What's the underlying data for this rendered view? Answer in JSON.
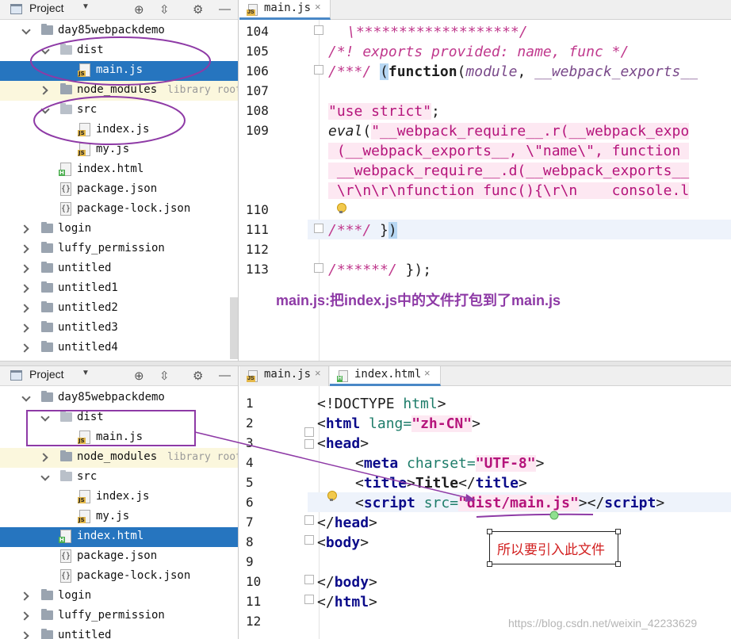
{
  "project_panel": {
    "title": "Project",
    "top_tree": [
      {
        "label": "day85webpackdemo",
        "type": "folder",
        "arrow": "down",
        "indent": 0
      },
      {
        "label": "dist",
        "type": "folder-light",
        "arrow": "down",
        "indent": 1
      },
      {
        "label": "main.js",
        "type": "js",
        "indent": 2,
        "selected": true
      },
      {
        "label": "node_modules",
        "type": "folder",
        "arrow": "right",
        "indent": 1,
        "extra": "library root"
      },
      {
        "label": "src",
        "type": "folder-light",
        "arrow": "down",
        "indent": 1
      },
      {
        "label": "index.js",
        "type": "js",
        "indent": 2
      },
      {
        "label": "my.js",
        "type": "js",
        "indent": 2
      },
      {
        "label": "index.html",
        "type": "html",
        "indent": 1
      },
      {
        "label": "package.json",
        "type": "json",
        "indent": 1
      },
      {
        "label": "package-lock.json",
        "type": "json",
        "indent": 1
      },
      {
        "label": "login",
        "type": "folder",
        "arrow": "right",
        "indent": 0
      },
      {
        "label": "luffy_permission",
        "type": "folder",
        "arrow": "right",
        "indent": 0
      },
      {
        "label": "untitled",
        "type": "folder",
        "arrow": "right",
        "indent": 0
      },
      {
        "label": "untitled1",
        "type": "folder",
        "arrow": "right",
        "indent": 0
      },
      {
        "label": "untitled2",
        "type": "folder",
        "arrow": "right",
        "indent": 0
      },
      {
        "label": "untitled3",
        "type": "folder",
        "arrow": "right",
        "indent": 0
      },
      {
        "label": "untitled4",
        "type": "folder",
        "arrow": "right",
        "indent": 0
      }
    ],
    "bottom_tree": [
      {
        "label": "day85webpackdemo",
        "type": "folder",
        "arrow": "down",
        "indent": 0
      },
      {
        "label": "dist",
        "type": "folder-light",
        "arrow": "down",
        "indent": 1
      },
      {
        "label": "main.js",
        "type": "js",
        "indent": 2
      },
      {
        "label": "node_modules",
        "type": "folder",
        "arrow": "right",
        "indent": 1,
        "extra": "library root"
      },
      {
        "label": "src",
        "type": "folder-light",
        "arrow": "down",
        "indent": 1
      },
      {
        "label": "index.js",
        "type": "js",
        "indent": 2
      },
      {
        "label": "my.js",
        "type": "js",
        "indent": 2
      },
      {
        "label": "index.html",
        "type": "html",
        "indent": 1,
        "selected": true
      },
      {
        "label": "package.json",
        "type": "json",
        "indent": 1
      },
      {
        "label": "package-lock.json",
        "type": "json",
        "indent": 1
      },
      {
        "label": "login",
        "type": "folder",
        "arrow": "right",
        "indent": 0
      },
      {
        "label": "luffy_permission",
        "type": "folder",
        "arrow": "right",
        "indent": 0
      },
      {
        "label": "untitled",
        "type": "folder",
        "arrow": "right",
        "indent": 0
      }
    ]
  },
  "top_editor": {
    "tabs": [
      {
        "label": "main.js",
        "close": "×",
        "active": true
      }
    ],
    "line_numbers": [
      "104",
      "105",
      "106",
      "107",
      "108",
      "109",
      "110",
      "111",
      "112",
      "113"
    ]
  },
  "bottom_editor": {
    "tabs": [
      {
        "label": "main.js",
        "close": "×",
        "active": false
      },
      {
        "label": "index.html",
        "close": "×",
        "active": true
      }
    ],
    "line_numbers": [
      "1",
      "2",
      "3",
      "4",
      "5",
      "6",
      "7",
      "8",
      "9",
      "10",
      "11",
      "12"
    ]
  },
  "code_top": {
    "l104": "\\*******************/",
    "l105": "/*! exports provided: name, func */",
    "l106_a": "/***/ ",
    "l106_b": "(",
    "l106_c": "function",
    "l106_d": "(",
    "l106_e": "module",
    "l106_f": ", ",
    "l106_g": "__webpack_exports__",
    "l108_a": "\"use strict\"",
    "l108_b": ";",
    "l109_a": "eval",
    "l109_b": "(",
    "l109_c": "\"__webpack_require__.r(__webpack_expo",
    "l109_w1": " (__webpack_exports__, \\\"name\\\", function ",
    "l109_w2": " __webpack_require__.d(__webpack_exports__",
    "l109_w3": " \\r\\n\\r\\nfunction func(){\\r\\n    console.l",
    "l111_a": "/***/ ",
    "l111_b": "}",
    "l111_c": ")",
    "l113_a": "/******/ ",
    "l113_b": "});"
  },
  "code_bottom": {
    "l1_a": "<!DOCTYPE ",
    "l1_b": "html",
    "l1_c": ">",
    "l2_a": "<",
    "l2_b": "html",
    "l2_c": " lang=",
    "l2_d": "\"zh-CN\"",
    "l2_e": ">",
    "l3_a": "<",
    "l3_b": "head",
    "l3_c": ">",
    "l4_a": "<",
    "l4_b": "meta",
    "l4_c": " charset=",
    "l4_d": "\"UTF-8\"",
    "l4_e": ">",
    "l5_a": "<",
    "l5_b": "title",
    "l5_c": ">",
    "l5_d": "Title",
    "l5_e": "</",
    "l5_f": "title",
    "l5_g": ">",
    "l6_a": "<",
    "l6_b": "script",
    "l6_c": " src=",
    "l6_d": "\"dist/main.js\"",
    "l6_e": "></",
    "l6_f": "script",
    "l6_g": ">",
    "l7_a": "</",
    "l7_b": "head",
    "l7_c": ">",
    "l8_a": "<",
    "l8_b": "body",
    "l8_c": ">",
    "l10_a": "</",
    "l10_b": "body",
    "l10_c": ">",
    "l11_a": "</",
    "l11_b": "html",
    "l11_c": ">"
  },
  "annotations": {
    "top_note": "main.js:把index.js中的文件打包到了main.js",
    "box_note": "所以要引入此文件",
    "watermark": "https://blog.csdn.net/weixin_42233629"
  },
  "colors": {
    "selection": "#2675bf",
    "annotation_purple": "#8e3aa6",
    "annotation_red": "#d22020",
    "string_pink": "#b5147b"
  }
}
